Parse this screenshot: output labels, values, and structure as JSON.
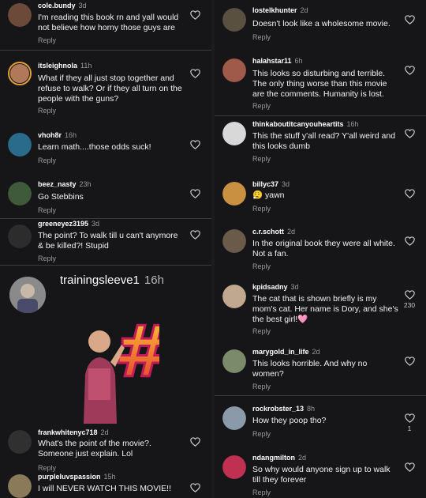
{
  "left_comments": [
    {
      "user": "cole.bundy",
      "time": "3d",
      "text": "I'm reading this book rn and yall would not believe how horny those guys are",
      "reply": "Reply",
      "avatar_color": "#6b4a3a"
    },
    {
      "user": "itsleighnola",
      "time": "11h",
      "text": "What if they all just stop together and refuse to walk? Or if they all turn on the people with the guns?",
      "reply": "Reply",
      "avatar_color": "#b07a5a"
    },
    {
      "user": "vhoh8r",
      "time": "16h",
      "text": "Learn math....those odds suck!",
      "reply": "Reply",
      "avatar_color": "#2a6a8a"
    },
    {
      "user": "beez_nasty",
      "time": "23h",
      "text": "Go Stebbins",
      "reply": "Reply",
      "avatar_color": "#3f5a3a"
    },
    {
      "user": "greeneyez3195",
      "time": "3d",
      "text": "The point? To walk till u can't anymore & be killed?! Stupid",
      "reply": "Reply",
      "avatar_color": "#2c2c2c"
    },
    {
      "user": "frankwhitenyc718",
      "time": "2d",
      "text": "What's the point of the movie?. Someone just explain. Lol",
      "reply": "Reply",
      "avatar_color": "#303030"
    },
    {
      "user": "purpleluvspassion",
      "time": "15h",
      "text": "I will NEVER WATCH THIS MOVIE!!",
      "reply": "",
      "avatar_color": "#8a7a5a"
    }
  ],
  "post": {
    "user": "trainingsleeve1",
    "time": "16h"
  },
  "right_comments": [
    {
      "user": "lostelkhunter",
      "time": "2d",
      "text": "Doesn't look like a wholesome movie.",
      "reply": "Reply",
      "avatar_color": "#5a5040",
      "likes": ""
    },
    {
      "user": "halahstar11",
      "time": "6h",
      "text": "This looks so disturbing and terrible. The only thing worse than this movie are the comments. Humanity is lost.",
      "reply": "Reply",
      "avatar_color": "#a05a4a",
      "likes": ""
    },
    {
      "user": "thinkaboutitcanyouheartits",
      "time": "16h",
      "text": "This the stuff y'all read? Y'all weird and this looks dumb",
      "reply": "Reply",
      "avatar_color": "#d8d8d8",
      "likes": ""
    },
    {
      "user": "billyc37",
      "time": "3d",
      "text": "😮‍💨 yawn",
      "reply": "Reply",
      "avatar_color": "#c89040",
      "likes": ""
    },
    {
      "user": "c.r.schott",
      "time": "2d",
      "text": "In the original book they were all white. Not a fan.",
      "reply": "Reply",
      "avatar_color": "#6a5a4a",
      "likes": ""
    },
    {
      "user": "kpidsadny",
      "time": "3d",
      "text": "The cat that is shown briefly is my mom's cat. Her name is Dory, and she's the best girl!🩷",
      "reply": "Reply",
      "avatar_color": "#c0a890",
      "likes": "230"
    },
    {
      "user": "marygold_in_life",
      "time": "2d",
      "text": "This looks horrible. And why no women?",
      "reply": "Reply",
      "avatar_color": "#7a8a6a",
      "likes": ""
    },
    {
      "user": "rockrobster_13",
      "time": "8h",
      "text": "How they poop tho?",
      "reply": "Reply",
      "avatar_color": "#8a9aa8",
      "likes": "1"
    },
    {
      "user": "ndangmilton",
      "time": "2d",
      "text": "So why would anyone sign up to walk till they forever",
      "reply": "Reply",
      "avatar_color": "#c03050",
      "likes": ""
    }
  ],
  "icons": {
    "like": "heart-icon"
  },
  "colors": {
    "background": "#161618",
    "ring": "#e0a03a",
    "muted": "#9a9a9a"
  }
}
